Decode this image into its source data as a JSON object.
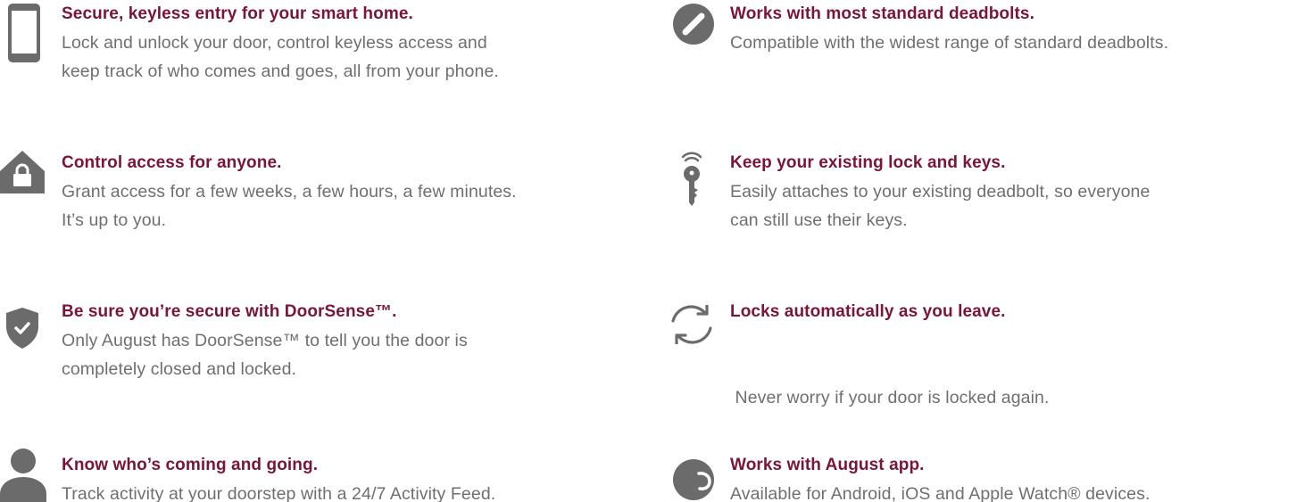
{
  "features": {
    "left": [
      {
        "icon": "phone-icon",
        "title": "Secure, keyless entry for your smart home.",
        "desc_lines": [
          "Lock and unlock your door, control keyless access and",
          "keep track of who comes and goes, all from your phone."
        ]
      },
      {
        "icon": "home-lock-icon",
        "title": "Control access for anyone.",
        "desc_lines": [
          "Grant access for a few weeks, a few hours, a few minutes.",
          "It’s up to you."
        ]
      },
      {
        "icon": "shield-check-icon",
        "title": "Be sure you’re secure with DoorSense™.",
        "desc_lines": [
          "Only August has DoorSense™ to tell you the door is",
          "completely closed and locked."
        ]
      },
      {
        "icon": "person-icon",
        "title": "Know who’s coming and going.",
        "desc_lines": [
          "Track activity at your doorstep with a 24/7 Activity Feed."
        ]
      }
    ],
    "right": [
      {
        "icon": "deadbolt-icon",
        "title": "Works with most standard deadbolts.",
        "desc_lines": [
          "Compatible with the widest range of standard deadbolts."
        ]
      },
      {
        "icon": "wireless-key-icon",
        "title": "Keep your existing lock and keys.",
        "desc_lines": [
          "Easily attaches to your existing deadbolt, so everyone",
          "can still use their keys."
        ]
      },
      {
        "icon": "auto-lock-refresh-icon",
        "title": "Locks automatically as you leave.",
        "desc_lines": [
          " Never worry if your door is locked again."
        ]
      },
      {
        "icon": "august-app-icon",
        "title": "Works with August app.",
        "desc_lines": [
          "Available for Android, iOS and Apple Watch® devices."
        ]
      }
    ]
  },
  "colors": {
    "title": "#7a1535",
    "description": "#6f6f6f",
    "icon": "#6b6b6b"
  }
}
